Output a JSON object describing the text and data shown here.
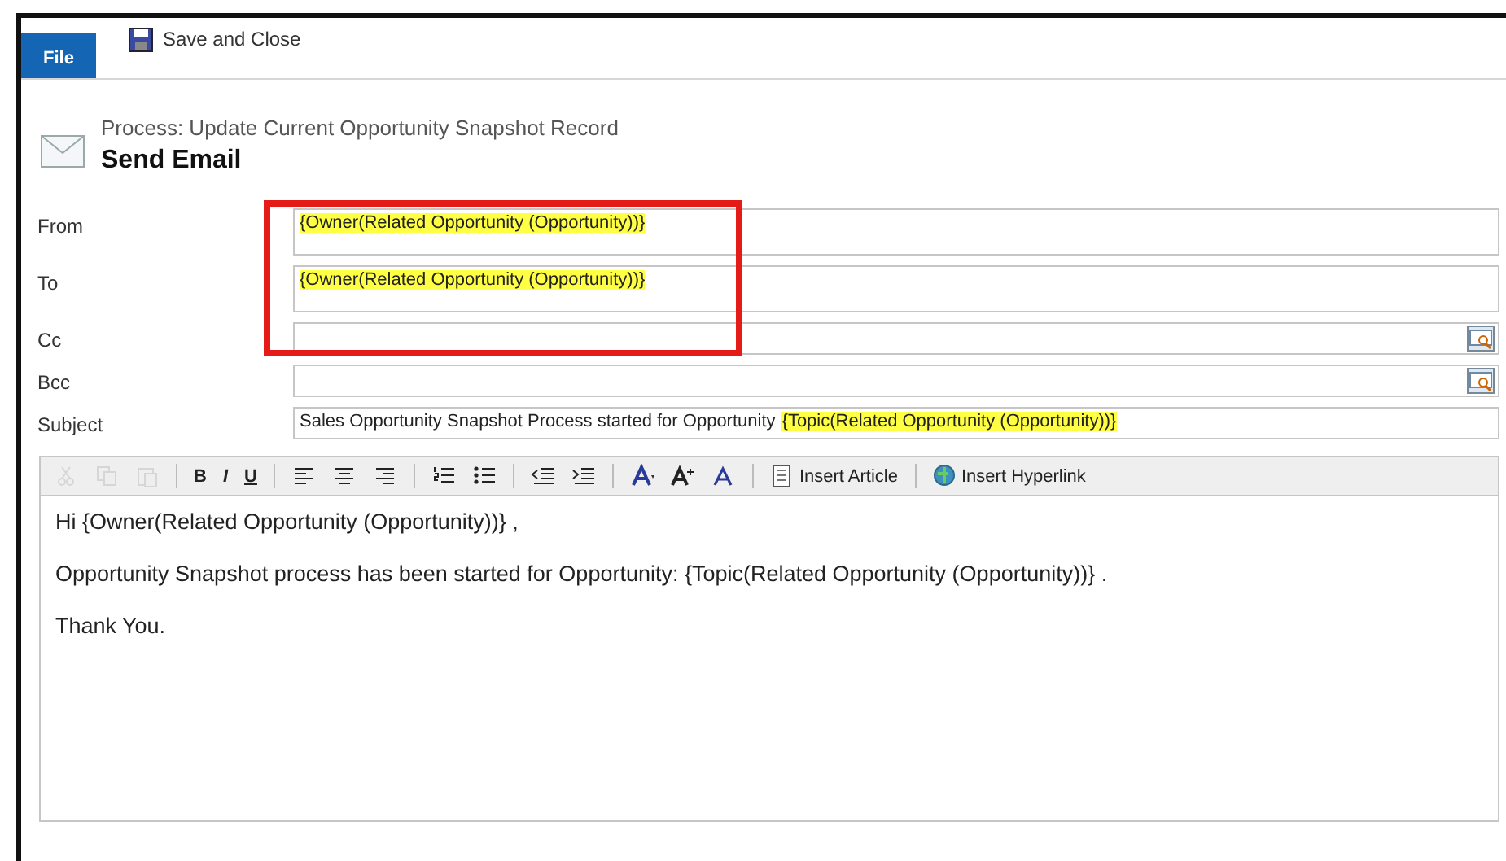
{
  "ribbon": {
    "tabs": [
      {
        "label": "File",
        "selected": true
      }
    ],
    "actions": [
      {
        "label": "Save and Close"
      }
    ]
  },
  "header": {
    "process": "Process: Update Current Opportunity Snapshot Record",
    "title": "Send Email"
  },
  "fields": [
    {
      "label": "From",
      "kind": "multiline",
      "value": [
        {
          "text": "{Owner(Related Opportunity (Opportunity))}",
          "highlighted": true
        }
      ]
    },
    {
      "label": "To",
      "kind": "multiline",
      "value": [
        {
          "text": "{Owner(Related Opportunity (Opportunity))}",
          "highlighted": true
        }
      ]
    },
    {
      "label": "Cc",
      "kind": "lookup"
    },
    {
      "label": "Bcc",
      "kind": "lookup"
    },
    {
      "label": "Subject",
      "kind": "single",
      "value": [
        {
          "text": "Sales Opportunity Snapshot Process started for Opportunity",
          "highlighted": false
        },
        {
          "text": "{Topic(Related Opportunity (Opportunity))}",
          "highlighted": true
        }
      ]
    }
  ],
  "toolbar": [
    [
      {
        "kind": "cut",
        "disabled": true
      },
      {
        "kind": "copy",
        "disabled": true
      },
      {
        "kind": "paste",
        "disabled": true
      }
    ],
    [
      {
        "kind": "bold",
        "label": "B",
        "disabled": false
      },
      {
        "kind": "italic",
        "label": "I",
        "disabled": false
      },
      {
        "kind": "underline",
        "label": "U",
        "disabled": false
      }
    ],
    [
      {
        "kind": "align-left",
        "disabled": false
      },
      {
        "kind": "align-center",
        "disabled": false
      },
      {
        "kind": "align-right",
        "disabled": false
      }
    ],
    [
      {
        "kind": "numbered-list",
        "disabled": false
      },
      {
        "kind": "bulleted-list",
        "disabled": false
      }
    ],
    [
      {
        "kind": "outdent",
        "disabled": false
      },
      {
        "kind": "indent",
        "disabled": false
      }
    ],
    [
      {
        "kind": "font",
        "disabled": false
      },
      {
        "kind": "font-size",
        "disabled": false
      },
      {
        "kind": "font-color",
        "disabled": false
      }
    ],
    [
      {
        "kind": "insert-article",
        "label": "Insert Article",
        "disabled": false
      }
    ],
    [
      {
        "kind": "insert-hyperlink",
        "label": "Insert Hyperlink",
        "disabled": false
      }
    ]
  ],
  "body": [
    "Hi {Owner(Related Opportunity (Opportunity))} ,",
    "Opportunity Snapshot process has been started for Opportunity: {Topic(Related Opportunity (Opportunity))} .",
    "Thank You."
  ]
}
